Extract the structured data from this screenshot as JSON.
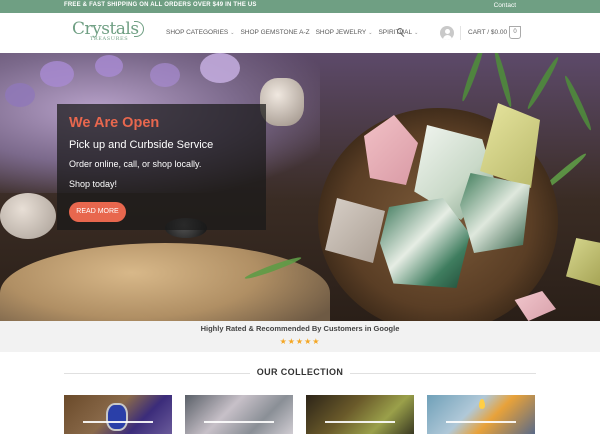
{
  "topbar": {
    "promo": "FREE & FAST SHIPPING ON ALL ORDERS OVER $49 IN THE US",
    "contact": "Contact"
  },
  "logo": {
    "main": "Crystals",
    "sub": "TREASURES"
  },
  "nav": {
    "items": [
      {
        "label": "SHOP CATEGORIES",
        "has_dropdown": true
      },
      {
        "label": "SHOP GEMSTONE A-Z",
        "has_dropdown": false
      },
      {
        "label": "SHOP JEWELRY",
        "has_dropdown": true
      },
      {
        "label": "SPIRITUAL",
        "has_dropdown": true
      }
    ],
    "search_icon": "search-icon"
  },
  "cart": {
    "label": "CART / $0.00",
    "count": "0"
  },
  "hero": {
    "heading": "We Are Open",
    "subheading": "Pick up and Curbside Service",
    "line1": "Order online, call, or shop locally.",
    "line2": "Shop today!",
    "cta": "READ MORE"
  },
  "reviews": {
    "text": "Highly Rated & Recommended By Customers in Google",
    "stars": "★★★★★",
    "rating": 5
  },
  "collection": {
    "title": "OUR COLLECTION",
    "cards": [
      {
        "name": "jewelry"
      },
      {
        "name": "crystals"
      },
      {
        "name": "herbs"
      },
      {
        "name": "candles"
      }
    ]
  },
  "colors": {
    "brand_green": "#6f9f83",
    "accent_coral": "#e8674e",
    "star": "#f4a623"
  }
}
